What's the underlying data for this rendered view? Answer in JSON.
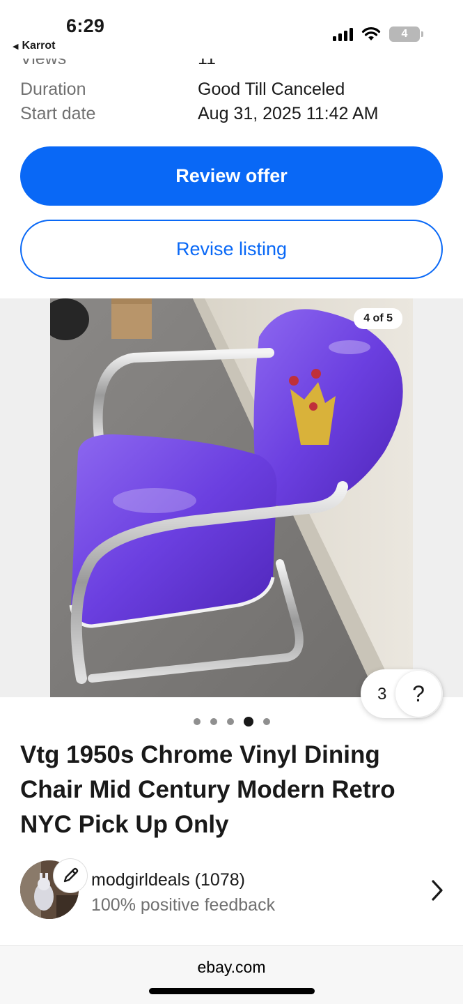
{
  "status": {
    "time": "6:29",
    "back_app": "Karrot",
    "battery": "4"
  },
  "details": [
    {
      "key": "Views",
      "value": "11"
    },
    {
      "key": "Duration",
      "value": "Good Till Canceled"
    },
    {
      "key": "Start date",
      "value": "Aug 31, 2025 11:42 AM"
    }
  ],
  "actions": {
    "review_offer": "Review offer",
    "revise_listing": "Revise listing"
  },
  "gallery": {
    "counter": "4 of 5",
    "current_index": 4,
    "total": 5
  },
  "help": {
    "count": "3",
    "question": "?"
  },
  "listing": {
    "title": "Vtg 1950s Chrome Vinyl Dining Chair Mid Century Modern Retro NYC Pick Up Only"
  },
  "seller": {
    "name": "modgirldeals (1078)",
    "feedback": "100% positive feedback"
  },
  "browser": {
    "url": "ebay.com"
  },
  "colors": {
    "accent": "#0968f6",
    "chair_vinyl": "#6b3fe0"
  }
}
